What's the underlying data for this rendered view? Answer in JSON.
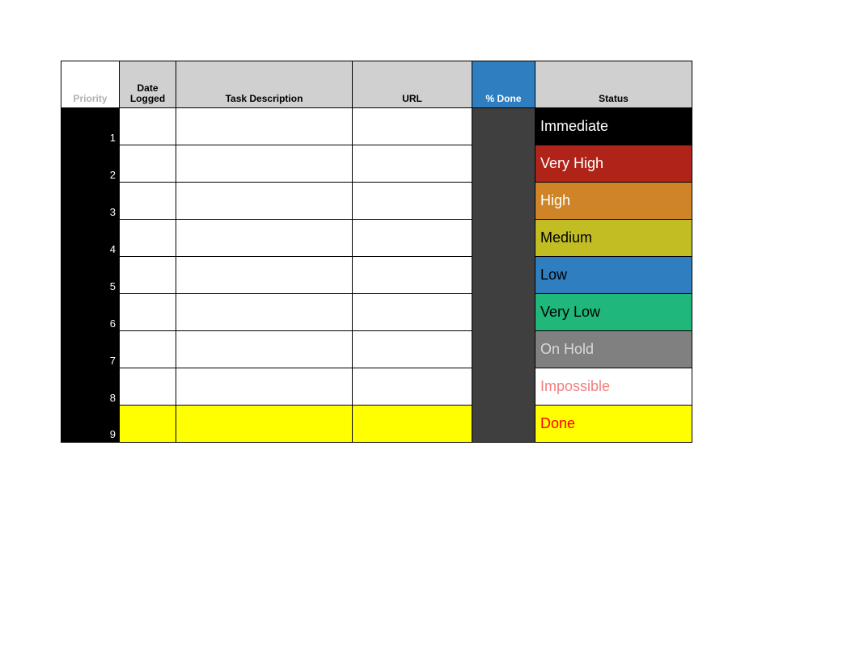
{
  "headers": {
    "priority": "Priority",
    "date_logged": "Date Logged",
    "task_description": "Task Description",
    "url": "URL",
    "percent_done": "% Done",
    "status": "Status"
  },
  "rows": [
    {
      "priority": "1",
      "date": "",
      "desc": "",
      "url": "",
      "done": "",
      "status": "Immediate",
      "status_class": "st-immediate",
      "row_class": ""
    },
    {
      "priority": "2",
      "date": "",
      "desc": "",
      "url": "",
      "done": "",
      "status": "Very High",
      "status_class": "st-veryhigh",
      "row_class": ""
    },
    {
      "priority": "3",
      "date": "",
      "desc": "",
      "url": "",
      "done": "",
      "status": "High",
      "status_class": "st-high",
      "row_class": ""
    },
    {
      "priority": "4",
      "date": "",
      "desc": "",
      "url": "",
      "done": "",
      "status": "Medium",
      "status_class": "st-medium",
      "row_class": ""
    },
    {
      "priority": "5",
      "date": "",
      "desc": "",
      "url": "",
      "done": "",
      "status": "Low",
      "status_class": "st-low",
      "row_class": ""
    },
    {
      "priority": "6",
      "date": "",
      "desc": "",
      "url": "",
      "done": "",
      "status": "Very Low",
      "status_class": "st-verylow",
      "row_class": ""
    },
    {
      "priority": "7",
      "date": "",
      "desc": "",
      "url": "",
      "done": "",
      "status": "On Hold",
      "status_class": "st-onhold",
      "row_class": ""
    },
    {
      "priority": "8",
      "date": "",
      "desc": "",
      "url": "",
      "done": "",
      "status": "Impossible",
      "status_class": "st-impossible",
      "row_class": ""
    },
    {
      "priority": "9",
      "date": "",
      "desc": "",
      "url": "",
      "done": "",
      "status": "Done",
      "status_class": "st-done",
      "row_class": "done"
    }
  ]
}
